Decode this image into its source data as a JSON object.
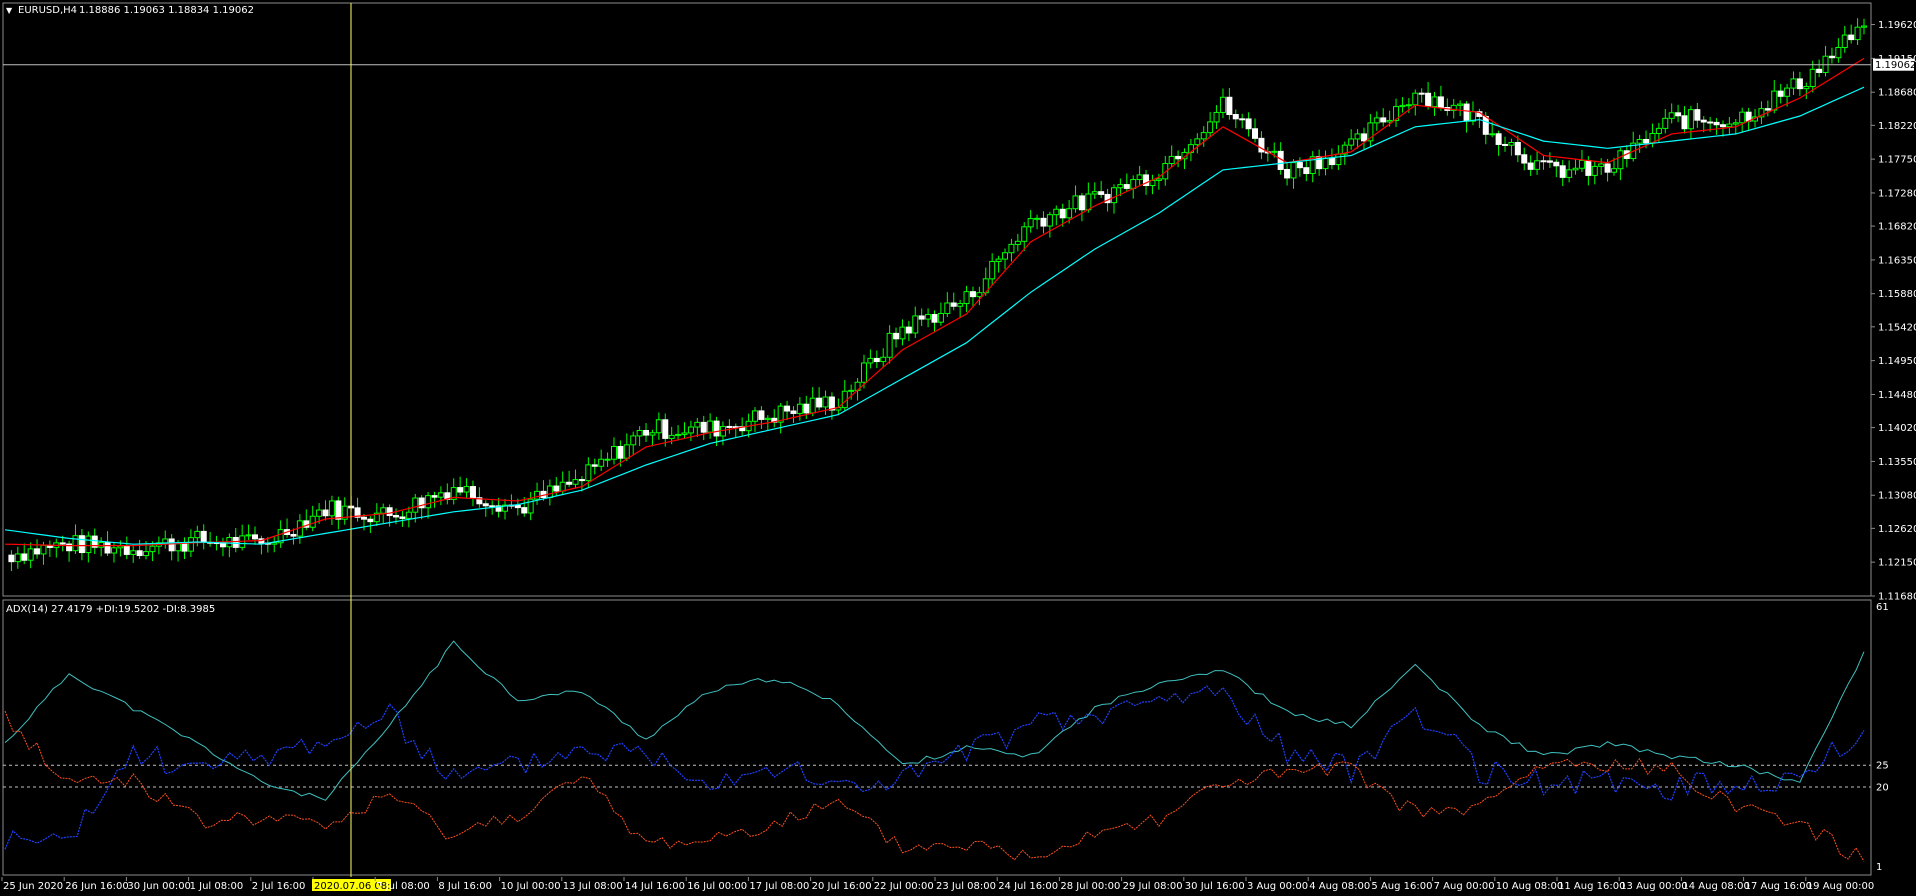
{
  "symbol": {
    "title": "EURUSD,H4",
    "ohlc": "1.18886 1.19063 1.18834 1.19062",
    "dropdown_glyph": "▼",
    "current_price_label": "1.19062"
  },
  "price_axis": {
    "labels": [
      "1.19620",
      "1.19150",
      "1.18680",
      "1.18220",
      "1.17750",
      "1.17280",
      "1.16820",
      "1.16350",
      "1.15880",
      "1.15420",
      "1.14950",
      "1.14480",
      "1.14020",
      "1.13550",
      "1.13080",
      "1.12620",
      "1.12150",
      "1.11680"
    ]
  },
  "indicator": {
    "label": "ADX(14) 27.4179 +DI:19.5202 -DI:8.3985",
    "scale_top": "61",
    "level_25": "25",
    "level_20": "20",
    "scale_bottom": "1"
  },
  "time_axis": {
    "labels": [
      "25 Jun 2020",
      "26 Jun 16:00",
      "30 Jun 00:00",
      "1 Jul 08:00",
      "2 Jul 16:00",
      "2020.07.06 08:00",
      "7 Jul 08:00",
      "8 Jul 16:00",
      "10 Jul 00:00",
      "13 Jul 08:00",
      "14 Jul 16:00",
      "16 Jul 00:00",
      "17 Jul 08:00",
      "20 Jul 16:00",
      "22 Jul 00:00",
      "23 Jul 08:00",
      "24 Jul 16:00",
      "28 Jul 00:00",
      "29 Jul 08:00",
      "30 Jul 16:00",
      "3 Aug 00:00",
      "4 Aug 08:00",
      "5 Aug 16:00",
      "7 Aug 00:00",
      "10 Aug 08:00",
      "11 Aug 16:00",
      "13 Aug 00:00",
      "14 Aug 08:00",
      "17 Aug 16:00",
      "19 Aug 00:00"
    ],
    "highlighted": "2020.07.06 08:00"
  },
  "chart_data": [
    {
      "type": "line",
      "title": "EURUSD,H4",
      "x": [
        "25 Jun 2020",
        "26 Jun 16:00",
        "30 Jun 00:00",
        "1 Jul 08:00",
        "2 Jul 16:00",
        "2020.07.06 08:00",
        "7 Jul 08:00",
        "8 Jul 16:00",
        "10 Jul 00:00",
        "13 Jul 08:00",
        "14 Jul 16:00",
        "16 Jul 00:00",
        "17 Jul 08:00",
        "20 Jul 16:00",
        "22 Jul 00:00",
        "23 Jul 08:00",
        "24 Jul 16:00",
        "28 Jul 00:00",
        "29 Jul 08:00",
        "30 Jul 16:00",
        "3 Aug 00:00",
        "4 Aug 08:00",
        "5 Aug 16:00",
        "7 Aug 00:00",
        "10 Aug 08:00",
        "11 Aug 16:00",
        "13 Aug 00:00",
        "14 Aug 08:00",
        "17 Aug 16:00",
        "19 Aug 00:00"
      ],
      "series": [
        {
          "color": "#00ff00",
          "values": [
            1.1225,
            1.124,
            1.1235,
            1.1245,
            1.124,
            1.129,
            1.128,
            1.132,
            1.129,
            1.133,
            1.14,
            1.14,
            1.142,
            1.144,
            1.154,
            1.158,
            1.169,
            1.172,
            1.176,
            1.185,
            1.176,
            1.179,
            1.187,
            1.183,
            1.176,
            1.176,
            1.183,
            1.183,
            1.188,
            1.196
          ]
        },
        {
          "color": "#ff0000",
          "values": [
            1.124,
            1.1238,
            1.1238,
            1.1242,
            1.1245,
            1.1275,
            1.1283,
            1.1305,
            1.13,
            1.132,
            1.1375,
            1.1395,
            1.141,
            1.143,
            1.151,
            1.156,
            1.166,
            1.171,
            1.175,
            1.182,
            1.177,
            1.1785,
            1.185,
            1.184,
            1.178,
            1.177,
            1.181,
            1.182,
            1.186,
            1.1915
          ]
        },
        {
          "color": "#00ffff",
          "values": [
            1.126,
            1.1248,
            1.124,
            1.1243,
            1.124,
            1.1255,
            1.127,
            1.1285,
            1.1295,
            1.1315,
            1.135,
            1.138,
            1.14,
            1.142,
            1.147,
            1.152,
            1.159,
            1.165,
            1.17,
            1.176,
            1.177,
            1.178,
            1.182,
            1.183,
            1.18,
            1.179,
            1.18,
            1.181,
            1.1835,
            1.1875
          ]
        }
      ],
      "ylim": [
        1.1168,
        1.1985
      ],
      "cursor_x": "2020.07.06 08:00"
    },
    {
      "type": "line",
      "title": "ADX(14) 27.4179 +DI:19.5202 -DI:8.3985",
      "x": [
        "25 Jun 2020",
        "26 Jun 16:00",
        "30 Jun 00:00",
        "1 Jul 08:00",
        "2 Jul 16:00",
        "2020.07.06 08:00",
        "7 Jul 08:00",
        "8 Jul 16:00",
        "10 Jul 00:00",
        "13 Jul 08:00",
        "14 Jul 16:00",
        "16 Jul 00:00",
        "17 Jul 08:00",
        "20 Jul 16:00",
        "22 Jul 00:00",
        "23 Jul 08:00",
        "24 Jul 16:00",
        "28 Jul 00:00",
        "29 Jul 08:00",
        "30 Jul 16:00",
        "3 Aug 00:00",
        "4 Aug 08:00",
        "5 Aug 16:00",
        "7 Aug 00:00",
        "10 Aug 08:00",
        "11 Aug 16:00",
        "13 Aug 00:00",
        "14 Aug 08:00",
        "17 Aug 16:00",
        "19 Aug 00:00"
      ],
      "series": [
        {
          "name": "ADX(14)",
          "color": "#40c0c0",
          "values": [
            30,
            46,
            38,
            30,
            21,
            17,
            34,
            53,
            40,
            42,
            31,
            42,
            45,
            39,
            25,
            29,
            27,
            38,
            44,
            47,
            37,
            34,
            48,
            34,
            27,
            30,
            27,
            25,
            21,
            51
          ]
        },
        {
          "name": "+DI",
          "color": "#2040ff",
          "values": [
            8,
            7,
            28,
            24,
            27,
            31,
            36,
            22,
            25,
            29,
            28,
            22,
            25,
            20,
            22,
            28,
            34,
            36,
            40,
            42,
            28,
            24,
            38,
            24,
            21,
            21,
            20,
            21,
            22,
            33
          ]
        },
        {
          "name": "-DI",
          "color": "#ff5020",
          "values": [
            36,
            21,
            22,
            12,
            13,
            11,
            18,
            9,
            14,
            22,
            7,
            8,
            12,
            16,
            6,
            7,
            4,
            10,
            13,
            21,
            23,
            24,
            14,
            15,
            25,
            25,
            24,
            16,
            12,
            3
          ]
        }
      ],
      "ylim": [
        1,
        61
      ],
      "levels": [
        25,
        20
      ]
    }
  ]
}
